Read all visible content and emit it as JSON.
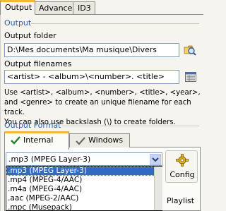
{
  "tabs": [
    {
      "label": "Output"
    },
    {
      "label": "Advanced"
    },
    {
      "label": "ID3"
    }
  ],
  "output": {
    "section_title": "Output",
    "folder_label": "Output folder",
    "folder_value": "D:\\Mes documents\\Ma musique\\Divers",
    "filenames_label": "Output filenames",
    "filenames_value": "<artist> - <album>\\<number>. <title>",
    "help_lines": [
      "Use <artist>, <album>, <number>, <title>, <year>,",
      "and <genre> to create an unique filename for each track.",
      "You can also use backslash (\\) to create folders."
    ]
  },
  "format": {
    "section_title": "Output Format",
    "tabs": [
      {
        "label": "Internal"
      },
      {
        "label": "Windows"
      }
    ],
    "selected": ".mp3 (MPEG Layer-3)",
    "options": [
      ".mp3 (MPEG Layer-3)",
      ".mp4 (MPEG-4/AAC)",
      ".m4a (MPEG-4/AAC)",
      ".aac (MPEG-2/AAC)",
      ".mpc (Musepack)"
    ],
    "config_label": "Config",
    "playlist_label": "Playlist"
  },
  "colors": {
    "accent_tab": "#f5b63c",
    "section_title": "#2a5ea6",
    "selection": "#316ac5"
  },
  "icons": {
    "browse": "folder-search-icon",
    "filename_options": "list-icon",
    "check": "checkmark-icon",
    "config": "gear-icon"
  }
}
